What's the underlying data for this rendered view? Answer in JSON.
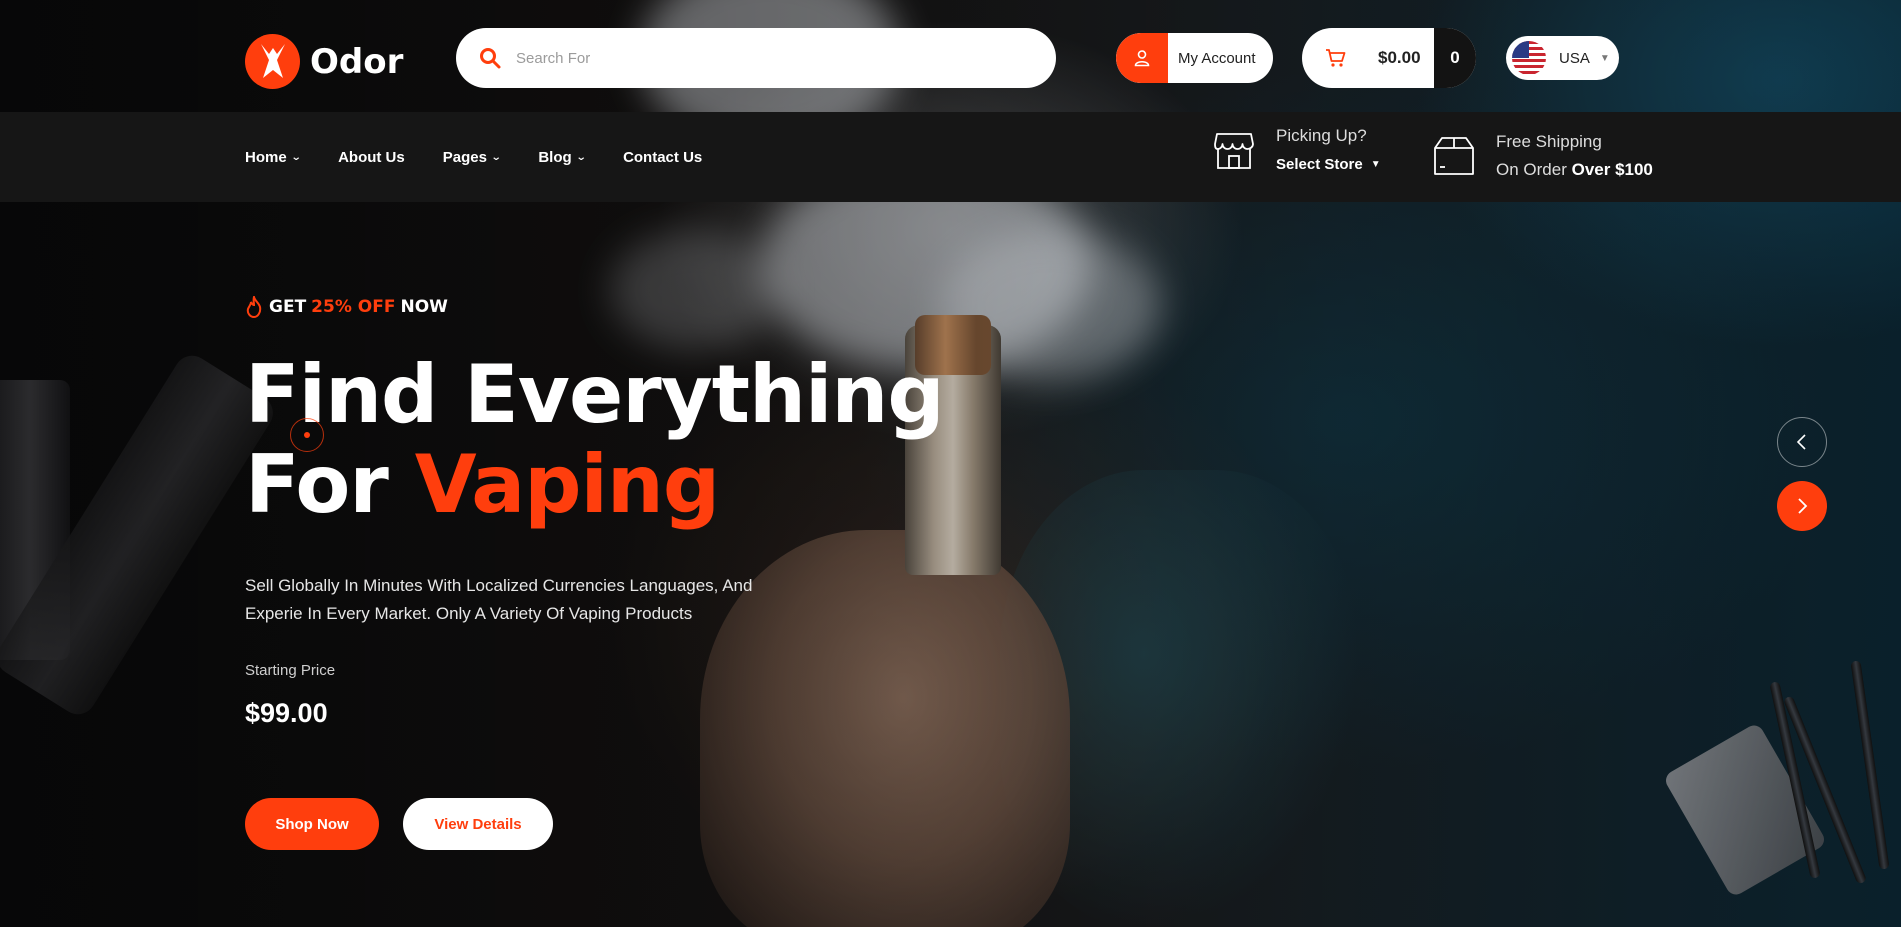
{
  "brand": {
    "name": "Odor",
    "accent": "#ff3e0d"
  },
  "search": {
    "placeholder": "Search For"
  },
  "account": {
    "label": "My Account"
  },
  "cart": {
    "total": "$0.00",
    "count": "0"
  },
  "language": {
    "label": "USA"
  },
  "nav": {
    "items": [
      {
        "label": "Home",
        "dropdown": true
      },
      {
        "label": "About Us",
        "dropdown": false
      },
      {
        "label": "Pages",
        "dropdown": true
      },
      {
        "label": "Blog",
        "dropdown": true
      },
      {
        "label": "Contact Us",
        "dropdown": false
      }
    ]
  },
  "pickup": {
    "question": "Picking Up?",
    "store": "Select Store"
  },
  "shipping": {
    "line1": "Free Shipping",
    "line2_prefix": "On Order",
    "line2_bold": "Over $100"
  },
  "hero": {
    "promo_pre": "GET",
    "promo_hl": "25% OFF",
    "promo_post": "NOW",
    "title_line1": "Find Everything",
    "title_line2_pre": "For",
    "title_line2_accent": "Vaping",
    "desc_line1": "Sell Globally In Minutes With Localized Currencies Languages, And",
    "desc_line2": "Experie In Every Market. Only A Variety Of Vaping Products",
    "price_label": "Starting Price",
    "price": "$99.00",
    "shop_button": "Shop Now",
    "details_button": "View Details"
  }
}
